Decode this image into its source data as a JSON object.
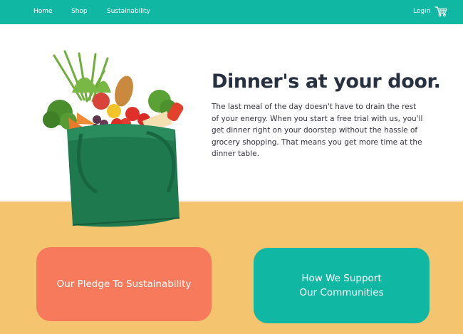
{
  "nav": {
    "links": [
      "Home",
      "Shop",
      "Sustainability"
    ],
    "login_label": "Login",
    "cart_icon": "shopping-cart-icon"
  },
  "hero": {
    "title": "Dinner's at your door.",
    "body": "The last meal of the day doesn't have to drain the rest of your energy. When you start a free trial with us, you'll get dinner right on your doorstep without the hassle of grocery shopping. That means you get more time at the dinner table.",
    "image": "grocery-bag-image"
  },
  "cards": {
    "pledge_label": "Our Pledge To Sustainability",
    "support_line1": "How We Support",
    "support_line2": "Our Communities"
  },
  "colors": {
    "nav_bg": "#10b8a3",
    "bottom_bg": "#f5c46e",
    "pledge_card": "#f77a5c",
    "support_card": "#10b8a3",
    "title_text": "#26303f"
  }
}
